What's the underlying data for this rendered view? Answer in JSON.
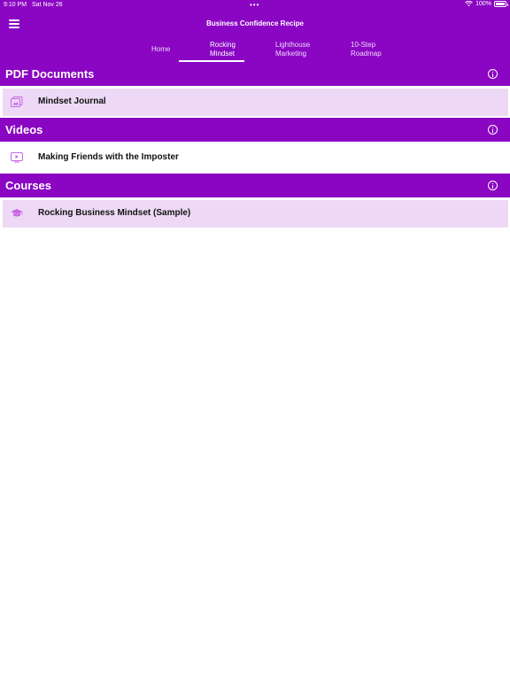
{
  "status_bar": {
    "time": "9:10 PM",
    "date": "Sat Nov 26",
    "dots": "•••",
    "battery": "100%"
  },
  "header": {
    "title": "Business Confidence Recipe"
  },
  "tabs": [
    {
      "line1": "Home",
      "line2": ""
    },
    {
      "line1": "Rocking",
      "line2": "Mindset"
    },
    {
      "line1": "Lighthouse",
      "line2": "Marketing"
    },
    {
      "line1": "10-Step",
      "line2": "Roadmap"
    }
  ],
  "active_tab": "Rocking Mindset",
  "sections": [
    {
      "title": "PDF Documents",
      "items": [
        {
          "label": "Mindset Journal",
          "icon": "pdf-icon"
        }
      ]
    },
    {
      "title": "Videos",
      "items": [
        {
          "label": "Making Friends with the Imposter",
          "icon": "video-icon"
        }
      ]
    },
    {
      "title": "Courses",
      "items": [
        {
          "label": "Rocking Business Mindset (Sample)",
          "icon": "graduation-cap-icon"
        }
      ]
    }
  ],
  "colors": {
    "brand": "#8a06c3",
    "highlight_row": "#edd9f5",
    "icon": "#c766e6"
  }
}
